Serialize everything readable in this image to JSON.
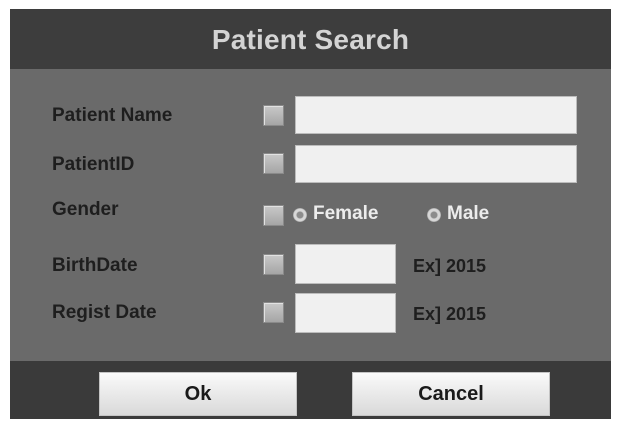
{
  "dialog": {
    "title": "Patient Search"
  },
  "fields": {
    "patient_name": {
      "label": "Patient Name",
      "value": ""
    },
    "patient_id": {
      "label": "PatientID",
      "value": ""
    },
    "gender": {
      "label": "Gender",
      "options": [
        "Female",
        "Male"
      ]
    },
    "birth_date": {
      "label": "BirthDate",
      "value": "",
      "hint": "Ex] 2015"
    },
    "regist_date": {
      "label": "Regist Date",
      "value": "",
      "hint": "Ex] 2015"
    }
  },
  "buttons": {
    "ok_label": "Ok",
    "cancel_label": "Cancel"
  }
}
